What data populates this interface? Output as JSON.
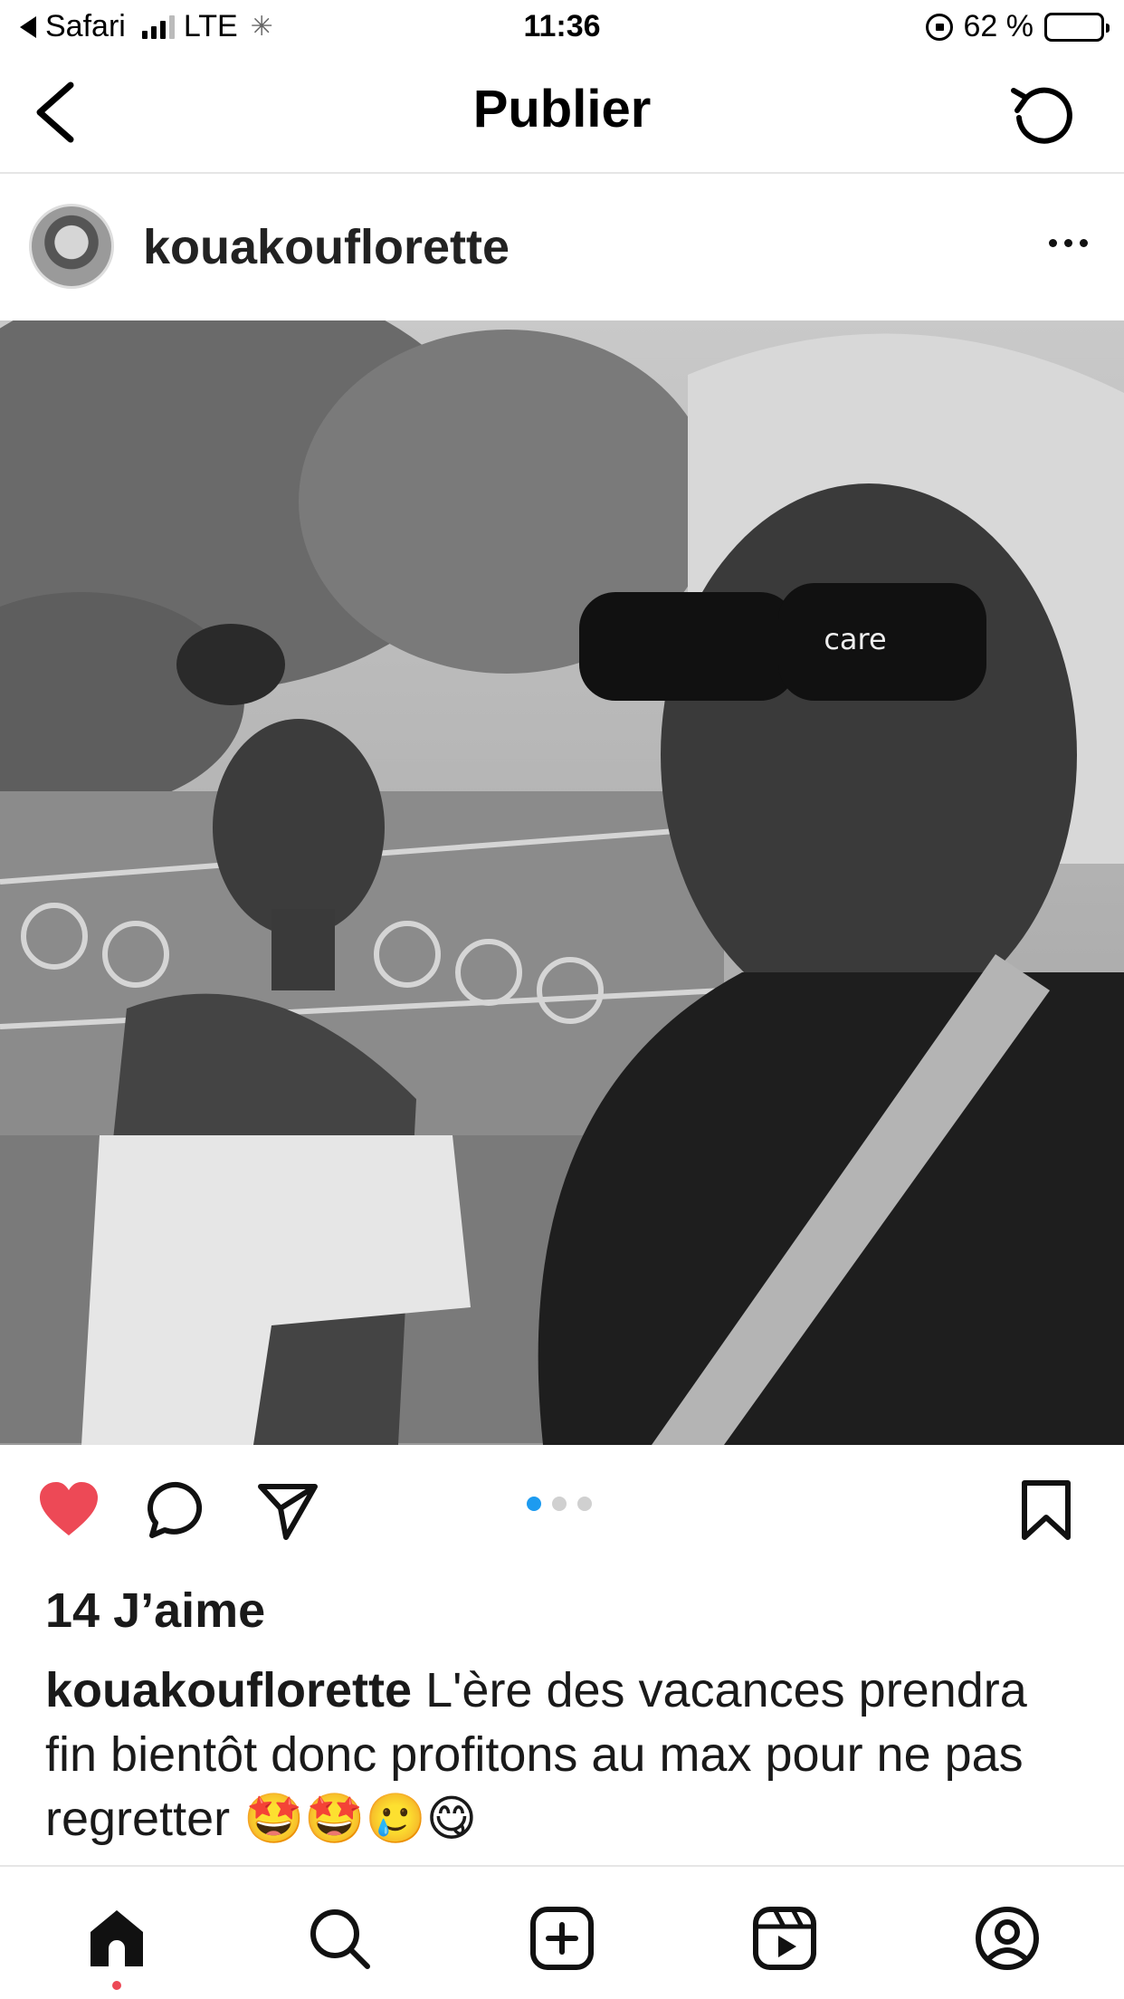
{
  "status_bar": {
    "back_app": "Safari",
    "network": "LTE",
    "time": "11:36",
    "battery_label": "62 %",
    "battery_level_percent": 62
  },
  "header": {
    "title": "Publier"
  },
  "post": {
    "username": "kouakouflorette",
    "photo_overlay_text": "care",
    "carousel": {
      "total": 3,
      "active_index": 0
    },
    "liked": true,
    "likes_label": "14 J’aime",
    "caption_user": "kouakouflorette",
    "caption_text": " L'ère des vacances prendra fin bientôt donc profitons au max pour ne pas regretter 🤩🤩🥲😋"
  },
  "colors": {
    "like_red": "#ed4956",
    "carousel_active": "#1d9bf0",
    "carousel_inactive": "#d0d0d0",
    "divider": "#e6e6e6"
  },
  "icons": {
    "back": "chevron-left-icon",
    "refresh": "refresh-icon",
    "more": "more-horizontal-icon",
    "like": "heart-icon",
    "comment": "comment-icon",
    "share": "send-icon",
    "save": "bookmark-icon",
    "tab_home": "home-icon",
    "tab_search": "search-icon",
    "tab_create": "add-post-icon",
    "tab_reels": "reels-icon",
    "tab_profile": "profile-icon"
  }
}
